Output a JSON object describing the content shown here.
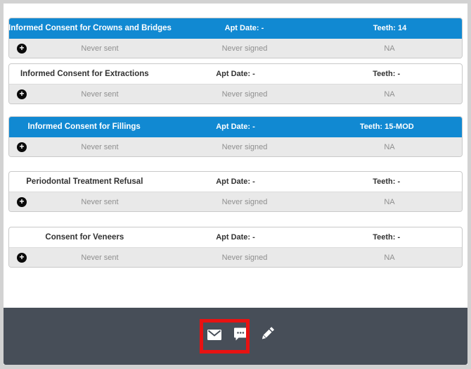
{
  "colors": {
    "frame": "#d2d2d2",
    "page-bg": "#ffffff",
    "accent-blue": "#1189d2",
    "row-gray": "#e9e9e9",
    "muted-text": "#8f8f8f",
    "dark-text": "#323232",
    "footer-bg": "#474e58",
    "highlight-red": "#e81212",
    "icon-black": "#0a0a0a"
  },
  "cards": [
    {
      "title": "Informed Consent for Crowns and Bridges",
      "apt_date": "Apt Date: -",
      "teeth": "Teeth: 14",
      "sent_status": "Never sent",
      "signed_status": "Never signed",
      "extra_status": "NA",
      "selected": true
    },
    {
      "title": "Informed Consent for Extractions",
      "apt_date": "Apt Date: -",
      "teeth": "Teeth: -",
      "sent_status": "Never sent",
      "signed_status": "Never signed",
      "extra_status": "NA",
      "selected": false
    },
    {
      "title": "Informed Consent for Fillings",
      "apt_date": "Apt Date: -",
      "teeth": "Teeth: 15-MOD",
      "sent_status": "Never sent",
      "signed_status": "Never signed",
      "extra_status": "NA",
      "selected": true
    },
    {
      "title": "Periodontal Treatment Refusal",
      "apt_date": "Apt Date: -",
      "teeth": "Teeth: -",
      "sent_status": "Never sent",
      "signed_status": "Never signed",
      "extra_status": "NA",
      "selected": false
    },
    {
      "title": "Consent for Veneers",
      "apt_date": "Apt Date: -",
      "teeth": "Teeth: -",
      "sent_status": "Never sent",
      "signed_status": "Never signed",
      "extra_status": "NA",
      "selected": false
    }
  ],
  "footer": {
    "icons": [
      "mail-icon",
      "chat-icon",
      "pencil-icon"
    ],
    "plus_glyph": "+"
  }
}
